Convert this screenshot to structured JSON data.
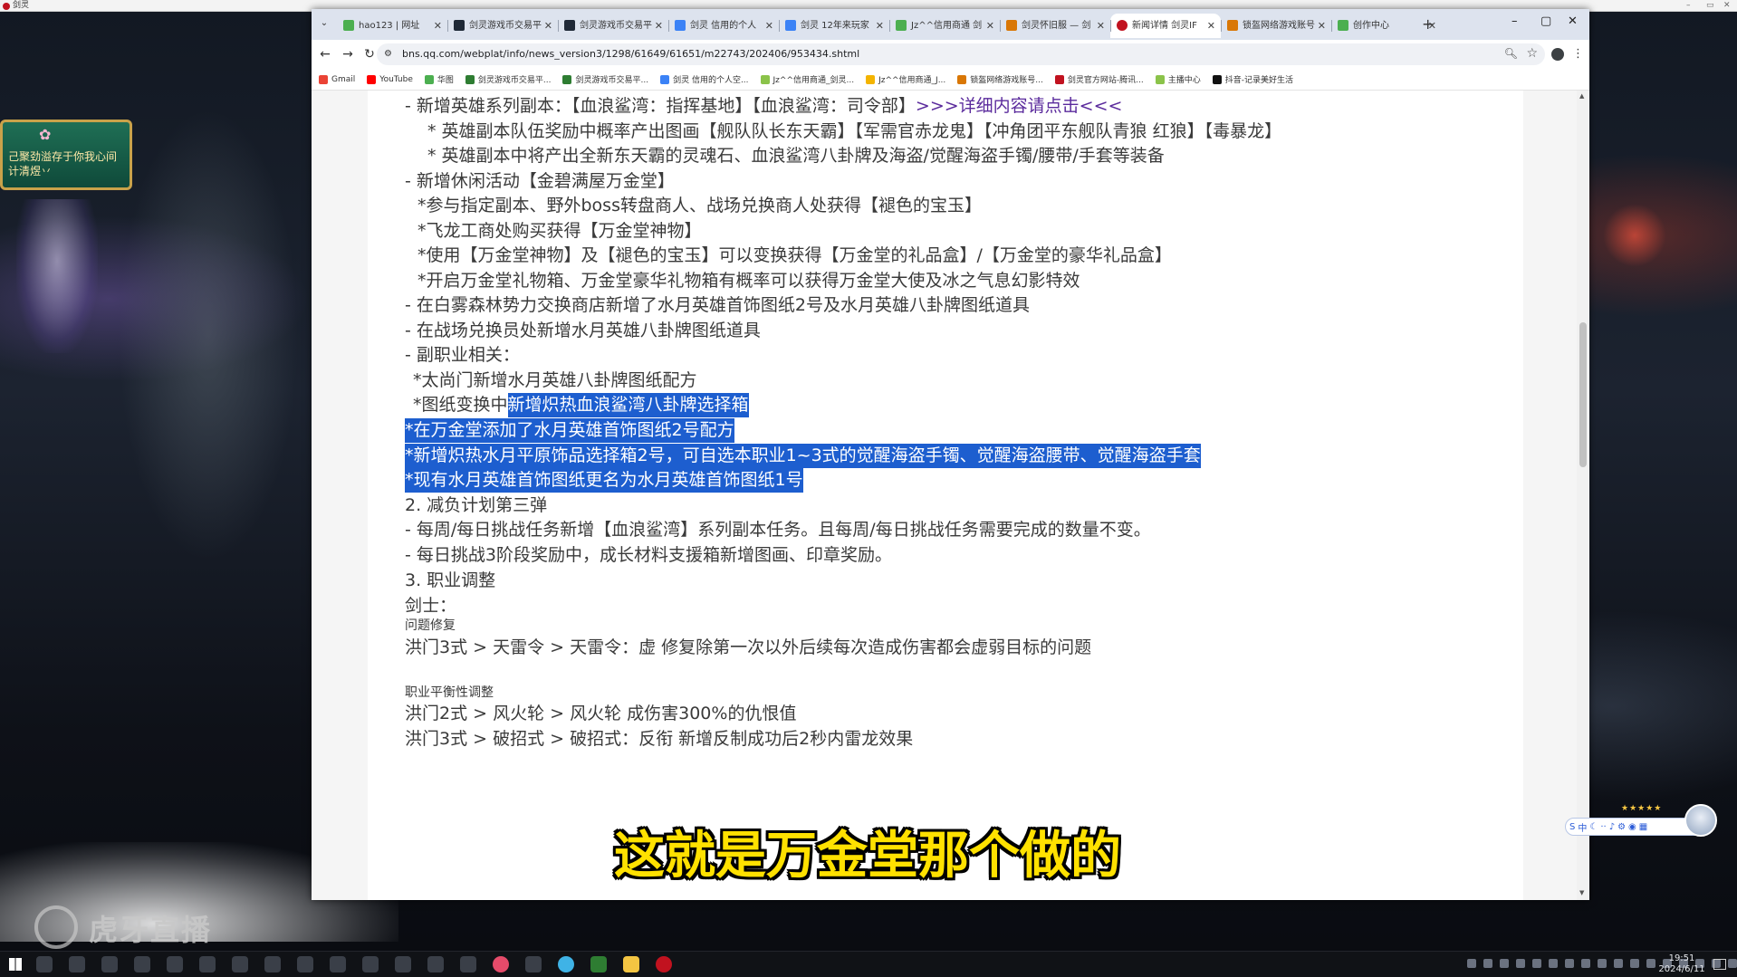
{
  "game": {
    "titlebar_text": "剑灵",
    "popup_text": "己聚劲溢存于你我心间 计清煜丷",
    "watermark_text": "虎牙直播"
  },
  "browser": {
    "tabs": [
      {
        "label": "hao123 | 网址",
        "favicon": "hao123-icon",
        "active": false
      },
      {
        "label": "剑灵游戏币交易平",
        "favicon": "trade-icon",
        "active": false
      },
      {
        "label": "剑灵游戏币交易平",
        "favicon": "trade-icon",
        "active": false
      },
      {
        "label": "剑灵 信用的个人",
        "favicon": "calendar-icon",
        "active": false
      },
      {
        "label": "剑灵 12年来玩家",
        "favicon": "calendar-icon",
        "active": false
      },
      {
        "label": "Jz^^信用商通 剑",
        "favicon": "leaf-icon",
        "active": false
      },
      {
        "label": "剑灵怀旧服 — 剑",
        "favicon": "game-icon",
        "active": false
      },
      {
        "label": "新闻详情 剑灵IF",
        "favicon": "bns-icon",
        "active": true
      },
      {
        "label": "锁盔网络游戏账号",
        "favicon": "game-icon",
        "active": false
      },
      {
        "label": "创作中心",
        "favicon": "leaf-icon",
        "active": false
      }
    ],
    "url": "bns.qq.com/webplat/info/news_version3/1298/61649/61651/m22743/202406/953434.shtml",
    "bookmarks": [
      {
        "label": "Gmail",
        "color": "#ea4335"
      },
      {
        "label": "YouTube",
        "color": "#ff0000"
      },
      {
        "label": "华图",
        "color": "#4caf50"
      },
      {
        "label": "剑灵游戏币交易平...",
        "color": "#2e7d32"
      },
      {
        "label": "剑灵游戏币交易平...",
        "color": "#2e7d32"
      },
      {
        "label": "剑灵 信用的个人空...",
        "color": "#3b82f6"
      },
      {
        "label": "Jz^^信用商通_剑灵...",
        "color": "#8bc34a"
      },
      {
        "label": "Jz^^信用商通_J...",
        "color": "#f4b400"
      },
      {
        "label": "锁盔网络游戏账号...",
        "color": "#d97706"
      },
      {
        "label": "剑灵官方网站-腾讯...",
        "color": "#c1121f"
      },
      {
        "label": "主播中心",
        "color": "#8bc34a"
      },
      {
        "label": "抖音-记录美好生活",
        "color": "#111111"
      }
    ]
  },
  "article": {
    "lines": [
      {
        "segments": [
          {
            "text": "-   新增英雄系列副本：【血浪鲨湾：指挥基地】【血浪鲨湾：司令部】"
          },
          {
            "text": ">>>详细内容请点击<<<",
            "style": "link"
          }
        ]
      },
      {
        "segments": [
          {
            "text": "* 英雄副本队伍奖励中概率产出图画【舰队队长东天霸】【军需官赤龙鬼】【冲角团平东舰队青狼 红狼】【毒暴龙】"
          }
        ]
      },
      {
        "segments": [
          {
            "text": "* 英雄副本中将产出全新东天霸的灵魂石、血浪鲨湾八卦牌及海盗/觉醒海盗手镯/腰带/手套等装备"
          }
        ]
      },
      {
        "segments": [
          {
            "text": "- 新增休闲活动【金碧满屋万金堂】"
          }
        ]
      },
      {
        "segments": [
          {
            "text": "*参与指定副本、野外boss转盘商人、战场兑换商人处获得【褪色的宝玉】"
          }
        ]
      },
      {
        "segments": [
          {
            "text": "*飞龙工商处购买获得【万金堂神物】"
          }
        ]
      },
      {
        "segments": [
          {
            "text": "*使用【万金堂神物】及【褪色的宝玉】可以变换获得【万金堂的礼品盒】/【万金堂的豪华礼品盒】"
          }
        ]
      },
      {
        "segments": [
          {
            "text": "*开启万金堂礼物箱、万金堂豪华礼物箱有概率可以获得万金堂大使及冰之气息幻影特效"
          }
        ]
      },
      {
        "segments": [
          {
            "text": "- 在白雾森林势力交换商店新增了水月英雄首饰图纸2号及水月英雄八卦牌图纸道具"
          }
        ]
      },
      {
        "segments": [
          {
            "text": "- 在战场兑换员处新增水月英雄八卦牌图纸道具"
          }
        ]
      },
      {
        "segments": [
          {
            "text": "- 副职业相关："
          }
        ]
      },
      {
        "segments": [
          {
            "text": "*太尚门新增水月英雄八卦牌图纸配方"
          }
        ]
      },
      {
        "segments": [
          {
            "text": "*图纸变换中"
          },
          {
            "text": "新增炽热血浪鲨湾八卦牌选择箱",
            "style": "hl"
          }
        ]
      },
      {
        "segments": [
          {
            "text": " *在万金堂添加了水月英雄首饰图纸2号配方 ",
            "style": "hl"
          }
        ]
      },
      {
        "segments": [
          {
            "text": " *新增炽热水月平原饰品选择箱2号，可自选本职业1~3式的觉醒海盗手镯、觉醒海盗腰带、觉醒海盗手套 ",
            "style": "hl"
          }
        ]
      },
      {
        "segments": [
          {
            "text": " *现有水月英雄首饰图纸更名为水月英雄首饰图纸1号 ",
            "style": "hl"
          }
        ]
      },
      {
        "segments": [
          {
            "text": "2. 减负计划第三弹"
          }
        ]
      },
      {
        "segments": [
          {
            "text": "- 每周/每日挑战任务新增【血浪鲨湾】系列副本任务。且每周/每日挑战任务需要完成的数量不变。"
          }
        ]
      },
      {
        "segments": [
          {
            "text": "- 每日挑战3阶段奖励中，成长材料支援箱新增图画、印章奖励。"
          }
        ]
      },
      {
        "segments": [
          {
            "text": "3. 职业调整"
          }
        ]
      },
      {
        "segments": [
          {
            "text": "剑士："
          }
        ]
      },
      {
        "segments": [
          {
            "text": "问题修复",
            "style": "small"
          }
        ]
      },
      {
        "segments": [
          {
            "text": "洪门3式 > 天雷令 > 天雷令：虚 修复除第一次以外后续每次造成伤害都会虚弱目标的问题"
          }
        ]
      },
      {
        "segments": [
          {
            "text": "职业平衡性调整",
            "style": "small"
          }
        ]
      },
      {
        "segments": [
          {
            "text": "洪门2式 > 风火轮 > 风火轮                                                    成伤害300%的仇恨值"
          }
        ]
      },
      {
        "segments": [
          {
            "text": "洪门3式 > 破招式 > 破招式：反衔 新增反制成功后2秒内雷龙效果"
          }
        ]
      }
    ]
  },
  "overlay": {
    "subtitle": "这就是万金堂那个做的",
    "clock_time": "19:51",
    "clock_date": "2024/6/11",
    "subtitle_color": "#ffe100"
  }
}
